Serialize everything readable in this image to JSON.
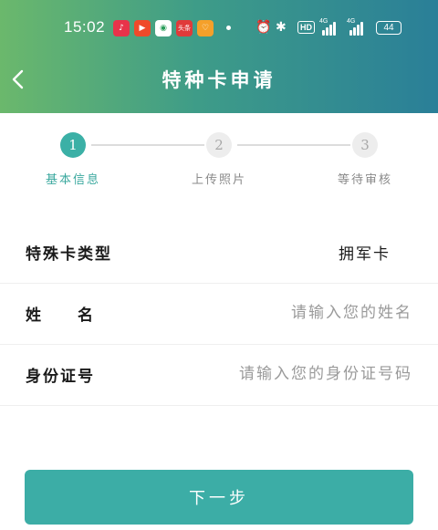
{
  "status_bar": {
    "time": "15:02",
    "app_icons": [
      {
        "name": "music-app-icon",
        "glyph": "♪",
        "color": "#e8334a"
      },
      {
        "name": "video-app-icon",
        "glyph": "▶",
        "color": "#f04a2a"
      },
      {
        "name": "shop-app-icon",
        "glyph": "◉",
        "color": "#ffffff"
      },
      {
        "name": "news-app-icon",
        "glyph": "头条",
        "color": "#e03a3a"
      },
      {
        "name": "health-app-icon",
        "glyph": "♡",
        "color": "#f5a02a"
      }
    ],
    "hd_label": "HD",
    "network_label_1": "4G",
    "network_label_2": "4G",
    "battery": "44"
  },
  "header": {
    "title": "特种卡申请",
    "back_icon": "chevron-left-icon"
  },
  "steps": [
    {
      "number": "1",
      "label": "基本信息",
      "state": "active"
    },
    {
      "number": "2",
      "label": "上传照片",
      "state": "inactive"
    },
    {
      "number": "3",
      "label": "等待审核",
      "state": "inactive"
    }
  ],
  "form": {
    "card_type": {
      "label": "特殊卡类型",
      "value": "拥军卡"
    },
    "name": {
      "label": "姓　　名",
      "placeholder": "请输入您的姓名"
    },
    "id_number": {
      "label": "身份证号",
      "placeholder": "请输入您的身份证号码"
    }
  },
  "actions": {
    "next_label": "下一步"
  },
  "colors": {
    "accent": "#3cada6",
    "header_start": "#6bb86c",
    "header_end": "#2a7f98"
  }
}
